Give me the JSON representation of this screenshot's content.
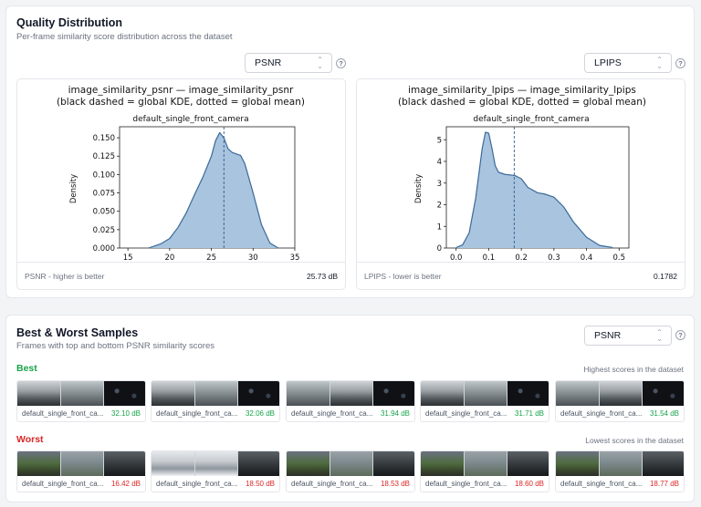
{
  "quality": {
    "title": "Quality Distribution",
    "subtitle": "Per-frame similarity score distribution across the dataset",
    "left_select": "PSNR",
    "right_select": "LPIPS",
    "help": "?",
    "psnr_panel": {
      "title1": "image_similarity_psnr — image_similarity_psnr",
      "title2": "(black dashed = global KDE, dotted = global mean)",
      "subtitle": "default_single_front_camera",
      "ylabel": "Density",
      "footer_label": "PSNR - higher is better",
      "footer_value": "25.73 dB"
    },
    "lpips_panel": {
      "title1": "image_similarity_lpips — image_similarity_lpips",
      "title2": "(black dashed = global KDE, dotted = global mean)",
      "subtitle": "default_single_front_camera",
      "ylabel": "Density",
      "footer_label": "LPIPS - lower is better",
      "footer_value": "0.1782"
    }
  },
  "samples": {
    "title": "Best & Worst Samples",
    "subtitle": "Frames with top and bottom PSNR similarity scores",
    "select": "PSNR",
    "help": "?",
    "best_label": "Best",
    "best_note": "Highest scores in the dataset",
    "worst_label": "Worst",
    "worst_note": "Lowest scores in the dataset",
    "best": [
      {
        "caption": "default_single_front_ca...",
        "value": "32.10 dB"
      },
      {
        "caption": "default_single_front_ca...",
        "value": "32.06 dB"
      },
      {
        "caption": "default_single_front_ca...",
        "value": "31.94 dB"
      },
      {
        "caption": "default_single_front_ca...",
        "value": "31.71 dB"
      },
      {
        "caption": "default_single_front_ca...",
        "value": "31.54 dB"
      }
    ],
    "worst": [
      {
        "caption": "default_single_front_ca...",
        "value": "16.42 dB"
      },
      {
        "caption": "default_single_front_ca...",
        "value": "18.50 dB"
      },
      {
        "caption": "default_single_front_ca...",
        "value": "18.53 dB"
      },
      {
        "caption": "default_single_front_ca...",
        "value": "18.60 dB"
      },
      {
        "caption": "default_single_front_ca...",
        "value": "18.77 dB"
      }
    ]
  },
  "chart_data": [
    {
      "type": "area",
      "title": "image_similarity_psnr — image_similarity_psnr",
      "subtitle": "default_single_front_camera",
      "ylabel": "Density",
      "xlim": [
        14,
        35
      ],
      "ylim": [
        0,
        0.165
      ],
      "xticks": [
        15,
        20,
        25,
        30,
        35
      ],
      "yticks": [
        0.0,
        0.025,
        0.05,
        0.075,
        0.1,
        0.125,
        0.15
      ],
      "ytick_labels": [
        "0.000",
        "0.025",
        "0.050",
        "0.075",
        "0.100",
        "0.125",
        "0.150"
      ],
      "mean": 26.5,
      "x": [
        17.5,
        18,
        19,
        20,
        21,
        22,
        23,
        24,
        25,
        25.5,
        26,
        26.5,
        27,
        27.5,
        28,
        28.5,
        29,
        30,
        31,
        32,
        33
      ],
      "y": [
        0,
        0.002,
        0.006,
        0.013,
        0.028,
        0.048,
        0.073,
        0.097,
        0.125,
        0.146,
        0.157,
        0.15,
        0.135,
        0.13,
        0.128,
        0.126,
        0.115,
        0.075,
        0.032,
        0.007,
        0
      ]
    },
    {
      "type": "area",
      "title": "image_similarity_lpips — image_similarity_lpips",
      "subtitle": "default_single_front_camera",
      "ylabel": "Density",
      "xlim": [
        -0.03,
        0.53
      ],
      "ylim": [
        0,
        5.6
      ],
      "xticks": [
        0.0,
        0.1,
        0.2,
        0.3,
        0.4,
        0.5
      ],
      "xtick_labels": [
        "0.0",
        "0.1",
        "0.2",
        "0.3",
        "0.4",
        "0.5"
      ],
      "yticks": [
        0,
        1,
        2,
        3,
        4,
        5
      ],
      "mean": 0.1782,
      "x": [
        0.0,
        0.02,
        0.04,
        0.06,
        0.08,
        0.09,
        0.1,
        0.11,
        0.12,
        0.13,
        0.15,
        0.18,
        0.2,
        0.22,
        0.25,
        0.27,
        0.3,
        0.33,
        0.36,
        0.4,
        0.44,
        0.48
      ],
      "y": [
        0.02,
        0.15,
        0.7,
        2.3,
        4.6,
        5.35,
        5.3,
        4.6,
        3.8,
        3.5,
        3.4,
        3.35,
        3.2,
        2.8,
        2.55,
        2.5,
        2.35,
        1.9,
        1.2,
        0.5,
        0.12,
        0.02
      ]
    }
  ]
}
